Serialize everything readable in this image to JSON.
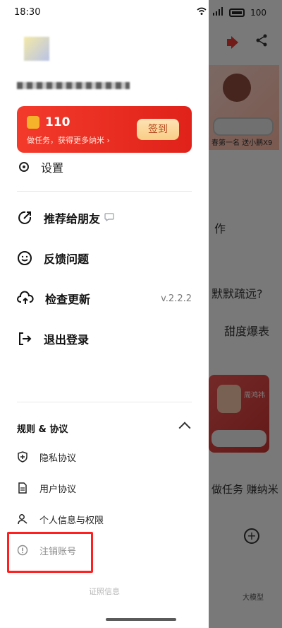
{
  "status_bar": {
    "time": "18:30",
    "battery": "100"
  },
  "background": {
    "banner_caption": "春第一名 送小鹏X9",
    "fragment_1": "作",
    "fragment_2": "默默疏远?",
    "fragment_3": "甜度爆表",
    "fragment_4": "做任务 赚纳米",
    "fragment_5": "大模型",
    "card_tag": "周鸿祎"
  },
  "points_card": {
    "value": "110",
    "subtitle": "做任务，获得更多纳米 ›",
    "signin_label": "签到"
  },
  "menu": {
    "settings_label": "设置",
    "items": [
      {
        "label": "推荐给朋友",
        "icon": "share-arrow-icon"
      },
      {
        "label": "反馈问题",
        "icon": "smile-icon"
      },
      {
        "label": "检查更新",
        "icon": "cloud-sync-icon",
        "version": "v.2.2.2"
      },
      {
        "label": "退出登录",
        "icon": "logout-icon"
      }
    ]
  },
  "rules": {
    "title": "规则 & 协议",
    "items": [
      {
        "label": "隐私协议",
        "icon": "shield-plus-icon"
      },
      {
        "label": "用户协议",
        "icon": "document-icon"
      },
      {
        "label": "个人信息与权限",
        "icon": "person-icon"
      },
      {
        "label": "注销账号",
        "icon": "info-circle-icon"
      }
    ]
  },
  "footer": {
    "cert_info": "证照信息"
  },
  "colors": {
    "accent_red": "#e0221a",
    "signin_bg": "#f9cd86",
    "highlight": "#ff1f1f"
  }
}
